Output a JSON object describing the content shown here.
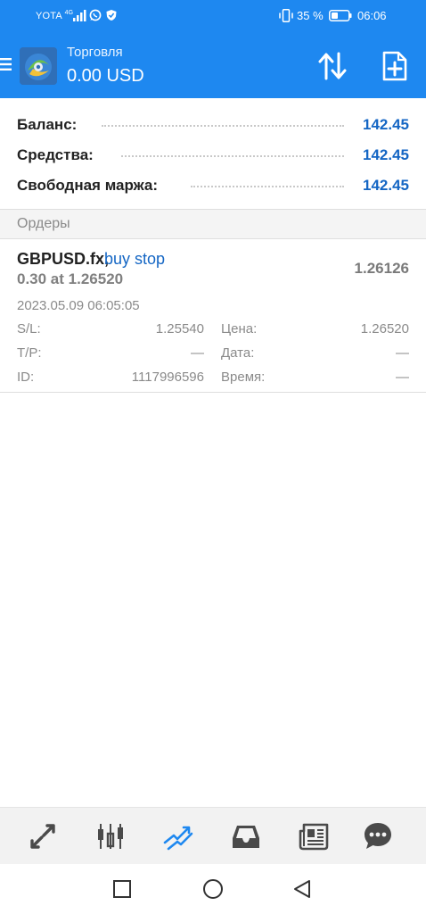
{
  "status_bar": {
    "carrier": "YOTA",
    "network": "4G",
    "battery_pct": "35 %",
    "time": "06:06"
  },
  "app_bar": {
    "title": "Торговля",
    "balance": "0.00 USD",
    "icons": [
      "menu-icon",
      "metatrader-logo",
      "sort-arrows-icon",
      "new-order-icon"
    ],
    "accent_color": "#1e88f0"
  },
  "summary": {
    "rows": [
      {
        "label": "Баланс:",
        "value": "142.45"
      },
      {
        "label": "Средства:",
        "value": "142.45"
      },
      {
        "label": "Свободная маржа:",
        "value": "142.45"
      }
    ],
    "value_color": "#1466c4"
  },
  "orders_section": {
    "title": "Ордеры"
  },
  "order": {
    "symbol": "GBPUSD.fx,",
    "type": "buy stop",
    "volume_at_price": "0.30 at 1.26520",
    "current_price": "1.26126",
    "open_time": "2023.05.09 06:05:05",
    "fields": {
      "sl_label": "S/L:",
      "sl_value": "1.25540",
      "price_label": "Цена:",
      "price_value": "1.26520",
      "tp_label": "T/P:",
      "tp_value": "—",
      "date_label": "Дата:",
      "date_value": "—",
      "id_label": "ID:",
      "id_value": "1117996596",
      "time_label": "Время:",
      "time_value": "—"
    }
  },
  "tabbar": {
    "tabs": [
      {
        "name": "quotes",
        "icon": "quotes-arrows-icon",
        "active": false
      },
      {
        "name": "chart",
        "icon": "candlestick-chart-icon",
        "active": false
      },
      {
        "name": "trade",
        "icon": "trade-trend-icon",
        "active": true
      },
      {
        "name": "history",
        "icon": "inbox-tray-icon",
        "active": false
      },
      {
        "name": "news",
        "icon": "newspaper-icon",
        "active": false
      },
      {
        "name": "messages",
        "icon": "chat-bubble-icon",
        "active": false
      }
    ],
    "active_color": "#1e88f0",
    "inactive_color": "#4a4a4a"
  },
  "nav_bar": {
    "icons": [
      "recent-apps-icon",
      "home-icon",
      "back-icon"
    ]
  }
}
